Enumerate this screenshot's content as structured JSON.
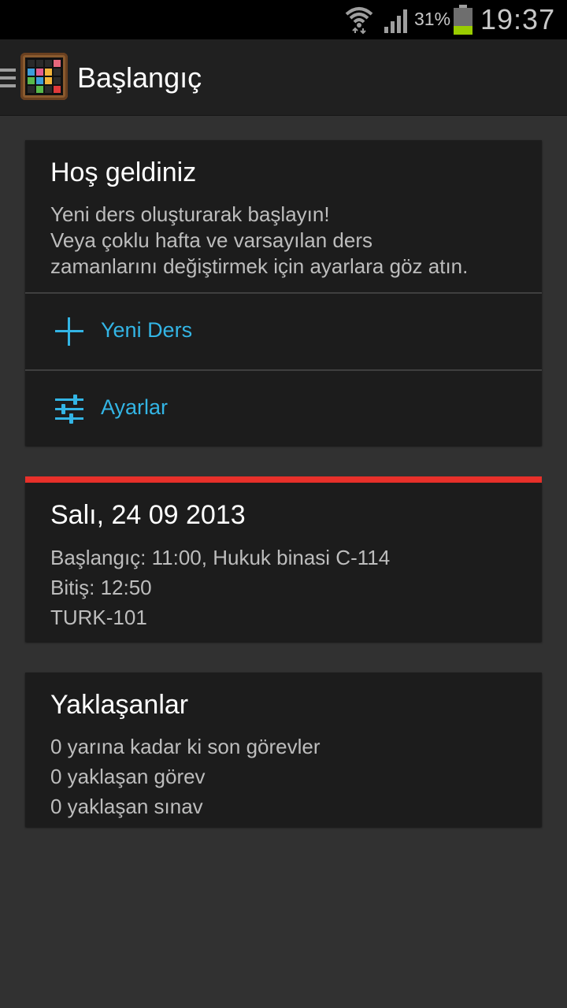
{
  "status_bar": {
    "battery_percent": "31%",
    "battery_level": 0.31,
    "time": "19:37",
    "icons": [
      "wifi-icon",
      "signal-icon",
      "battery-icon"
    ]
  },
  "action_bar": {
    "title": "Başlangıç",
    "icons": [
      "drawer-icon",
      "app-logo"
    ]
  },
  "welcome": {
    "title": "Hoş geldiniz",
    "lines": [
      "Yeni ders oluşturarak başlayın!",
      "Veya çoklu hafta ve varsayılan ders",
      "zamanlarını değiştirmek için ayarlara göz atın."
    ],
    "new_lesson_label": "Yeni Ders",
    "settings_label": "Ayarlar"
  },
  "lesson": {
    "date": "Salı, 24 09 2013",
    "start": "Başlangıç: 11:00, Hukuk binasi C-114",
    "end": "Bitiş: 12:50",
    "course": "TURK-101",
    "accent_color": "#e8302a"
  },
  "upcoming": {
    "title": "Yaklaşanlar",
    "lines": [
      "0 yarına kadar ki son görevler",
      "0 yaklaşan görev",
      "0 yaklaşan sınav"
    ]
  },
  "colors": {
    "accent_blue": "#33b5e5",
    "battery_green": "#99cc00"
  }
}
